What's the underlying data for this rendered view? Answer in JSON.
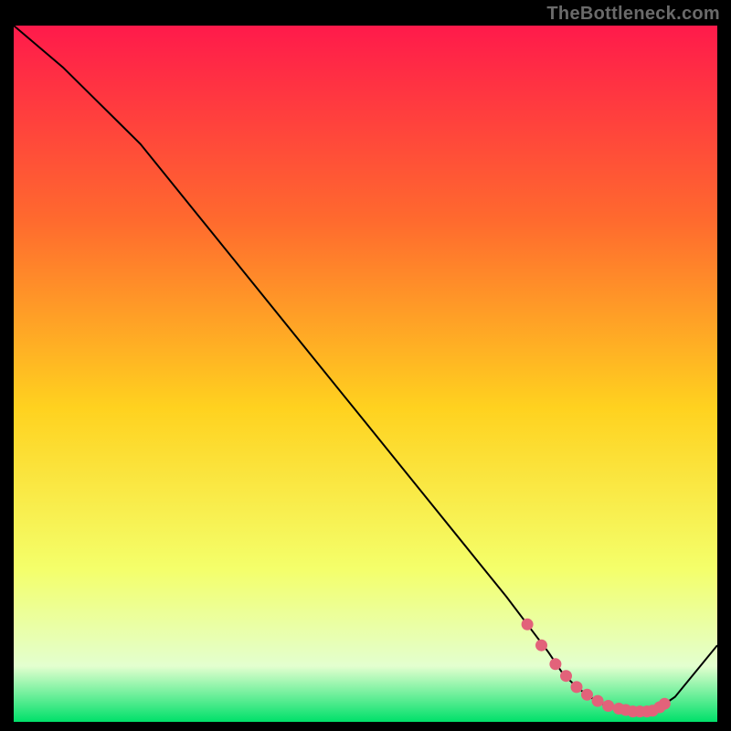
{
  "watermark": "TheBottleneck.com",
  "colors": {
    "bg": "#000000",
    "grad_top": "#ff1a4b",
    "grad_mid_upper": "#ff6a2e",
    "grad_mid": "#ffd21f",
    "grad_lower": "#f4ff6a",
    "grad_pale": "#e3ffcf",
    "grad_bottom": "#00e06a",
    "line": "#000000",
    "marker": "#e2627a"
  },
  "chart_data": {
    "type": "line",
    "title": "",
    "xlabel": "",
    "ylabel": "",
    "xlim": [
      0,
      100
    ],
    "ylim": [
      0,
      100
    ],
    "x": [
      0,
      7,
      12,
      18,
      26,
      34,
      42,
      50,
      58,
      66,
      70,
      73,
      76,
      78,
      80,
      82,
      84,
      86,
      88,
      90,
      91,
      92,
      94,
      100
    ],
    "y": [
      100,
      94,
      89,
      83,
      73,
      63,
      53,
      43,
      33,
      23,
      18,
      14,
      10,
      7,
      5,
      3.5,
      2.4,
      1.8,
      1.5,
      1.5,
      1.7,
      2.2,
      3.6,
      11
    ],
    "markers": {
      "x": [
        73,
        75,
        77,
        78.5,
        80,
        81.5,
        83,
        84.5,
        86,
        87,
        88,
        89,
        90,
        90.8,
        91.8,
        92.5
      ],
      "y": [
        14,
        11,
        8.3,
        6.6,
        5,
        3.9,
        3,
        2.3,
        1.9,
        1.7,
        1.5,
        1.5,
        1.5,
        1.6,
        2.1,
        2.6
      ]
    }
  }
}
